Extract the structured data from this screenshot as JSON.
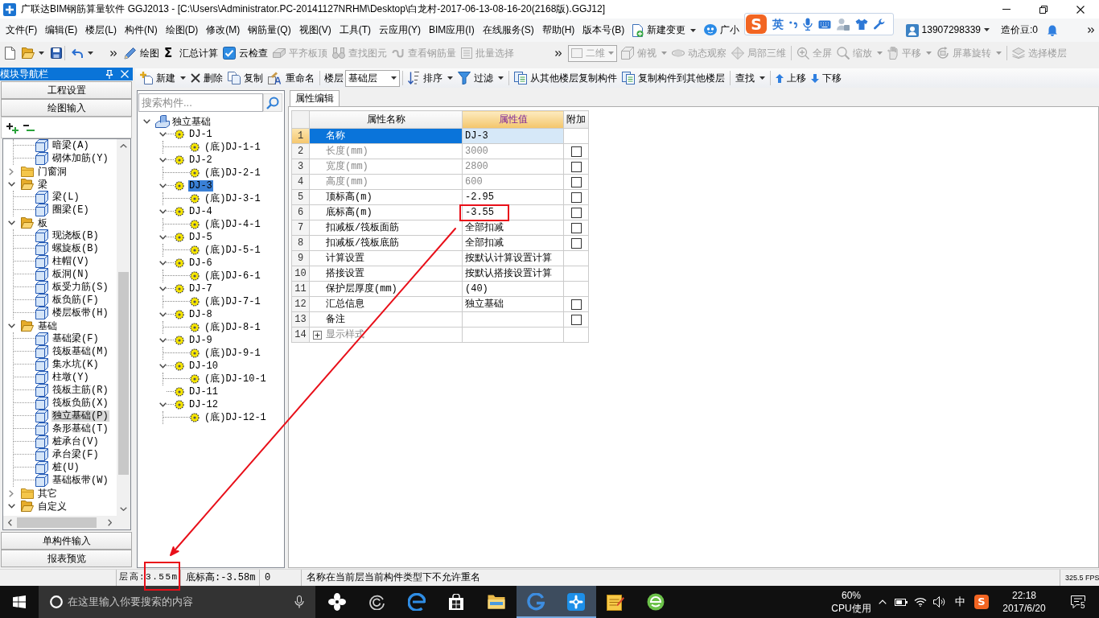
{
  "window": {
    "title": "广联达BIM钢筋算量软件 GGJ2013 - [C:\\Users\\Administrator.PC-20141127NRHM\\Desktop\\白龙村-2017-06-13-08-16-20(2168版).GGJ12]"
  },
  "menu_bar": {
    "items": [
      "文件(F)",
      "编辑(E)",
      "楼层(L)",
      "构件(N)",
      "绘图(D)",
      "修改(M)",
      "钢筋量(Q)",
      "视图(V)",
      "工具(T)",
      "云应用(Y)",
      "BIM应用(I)",
      "在线服务(S)",
      "帮助(H)",
      "版本号(B)"
    ],
    "change": {
      "label": "新建变更"
    },
    "assistant": {
      "label": "广小"
    },
    "account": {
      "phone": "13907298339",
      "beans": "造价豆:0"
    }
  },
  "ime_bar": {
    "logo": "S",
    "mode": "英"
  },
  "toolbar": {
    "actions": [
      {
        "label": "绘图",
        "disabled": false
      },
      {
        "label": "汇总计算",
        "symbol": "Σ",
        "disabled": false
      },
      {
        "label": "云检查",
        "disabled": false
      },
      {
        "label": "平齐板顶",
        "disabled": true
      },
      {
        "label": "查找图元",
        "disabled": true
      },
      {
        "label": "查看钢筋量",
        "disabled": true
      },
      {
        "label": "批量选择",
        "disabled": true
      }
    ],
    "view_mode": {
      "value": "二维",
      "disabled": true
    },
    "view_tools": [
      {
        "label": "俯视",
        "dropdown": true,
        "disabled": true
      },
      {
        "label": "动态观察",
        "dropdown": false,
        "disabled": true
      },
      {
        "label": "局部三维",
        "dropdown": false,
        "disabled": true
      },
      {
        "label": "全屏",
        "dropdown": false,
        "disabled": true
      },
      {
        "label": "缩放",
        "dropdown": true,
        "disabled": true
      },
      {
        "label": "平移",
        "dropdown": true,
        "disabled": true
      },
      {
        "label": "屏幕旋转",
        "dropdown": true,
        "disabled": true
      },
      {
        "label": "选择楼层",
        "dropdown": false,
        "disabled": true
      }
    ]
  },
  "component_toolbar": {
    "groups": [
      {
        "kind": "buttons",
        "buttons": [
          {
            "label": "新建",
            "dropdown": true
          },
          {
            "label": "删除",
            "dropdown": false
          },
          {
            "label": "复制",
            "dropdown": false
          },
          {
            "label": "重命名",
            "dropdown": false
          }
        ]
      },
      {
        "kind": "floor_select",
        "label": "楼层",
        "value": "基础层"
      },
      {
        "kind": "buttons",
        "buttons": [
          {
            "label": "排序",
            "dropdown": true
          },
          {
            "label": "过滤",
            "dropdown": true
          }
        ]
      },
      {
        "kind": "buttons",
        "buttons": [
          {
            "label": "从其他楼层复制构件",
            "dropdown": false
          },
          {
            "label": "复制构件到其他楼层",
            "dropdown": false
          }
        ]
      },
      {
        "kind": "buttons",
        "buttons": [
          {
            "label": "查找",
            "dropdown": true
          }
        ]
      },
      {
        "kind": "buttons",
        "buttons": [
          {
            "label": "上移",
            "dropdown": false
          },
          {
            "label": "下移",
            "dropdown": false
          }
        ]
      }
    ]
  },
  "nav_panel": {
    "title": "模块导航栏",
    "top_sections": [
      "工程设置",
      "绘图输入"
    ],
    "tree": [
      {
        "children": [
          {
            "label": "暗梁(A)",
            "selected": false
          },
          {
            "label": "砌体加筋(Y)",
            "selected": false
          }
        ]
      },
      {
        "label": "门窗洞",
        "expanded": false
      },
      {
        "label": "梁",
        "expanded": true,
        "children": [
          {
            "label": "梁(L)",
            "selected": false
          },
          {
            "label": "圈梁(E)",
            "selected": false
          }
        ]
      },
      {
        "label": "板",
        "expanded": true,
        "children": [
          {
            "label": "现浇板(B)",
            "selected": false
          },
          {
            "label": "螺旋板(B)",
            "selected": false
          },
          {
            "label": "柱帽(V)",
            "selected": false
          },
          {
            "label": "板洞(N)",
            "selected": false
          },
          {
            "label": "板受力筋(S)",
            "selected": false
          },
          {
            "label": "板负筋(F)",
            "selected": false
          },
          {
            "label": "楼层板带(H)",
            "selected": false
          }
        ]
      },
      {
        "label": "基础",
        "expanded": true,
        "children": [
          {
            "label": "基础梁(F)",
            "selected": false
          },
          {
            "label": "筏板基础(M)",
            "selected": false
          },
          {
            "label": "集水坑(K)",
            "selected": false
          },
          {
            "label": "柱墩(Y)",
            "selected": false
          },
          {
            "label": "筏板主筋(R)",
            "selected": false
          },
          {
            "label": "筏板负筋(X)",
            "selected": false
          },
          {
            "label": "独立基础(P)",
            "selected": true
          },
          {
            "label": "条形基础(T)",
            "selected": false
          },
          {
            "label": "桩承台(V)",
            "selected": false
          },
          {
            "label": "承台梁(F)",
            "selected": false
          },
          {
            "label": "桩(U)",
            "selected": false
          },
          {
            "label": "基础板带(W)",
            "selected": false
          }
        ]
      },
      {
        "label": "其它",
        "expanded": false
      },
      {
        "label": "自定义",
        "expanded": true
      }
    ],
    "bottom_sections": [
      "单构件输入",
      "报表预览"
    ]
  },
  "component_tree": {
    "search": {
      "placeholder": "搜索构件..."
    },
    "root": {
      "label": "独立基础",
      "expanded": true,
      "children": [
        {
          "label": "DJ-1",
          "expanded": true,
          "selected": false,
          "children": [
            {
              "label": "(底)DJ-1-1",
              "selected": false
            }
          ]
        },
        {
          "label": "DJ-2",
          "expanded": true,
          "selected": false,
          "children": [
            {
              "label": "(底)DJ-2-1",
              "selected": false
            }
          ]
        },
        {
          "label": "DJ-3",
          "expanded": true,
          "selected": true,
          "children": [
            {
              "label": "(底)DJ-3-1",
              "selected": false
            }
          ]
        },
        {
          "label": "DJ-4",
          "expanded": true,
          "selected": false,
          "children": [
            {
              "label": "(底)DJ-4-1",
              "selected": false
            }
          ]
        },
        {
          "label": "DJ-5",
          "expanded": true,
          "selected": false,
          "children": [
            {
              "label": "(底)DJ-5-1",
              "selected": false
            }
          ]
        },
        {
          "label": "DJ-6",
          "expanded": true,
          "selected": false,
          "children": [
            {
              "label": "(底)DJ-6-1",
              "selected": false
            }
          ]
        },
        {
          "label": "DJ-7",
          "expanded": true,
          "selected": false,
          "children": [
            {
              "label": "(底)DJ-7-1",
              "selected": false
            }
          ]
        },
        {
          "label": "DJ-8",
          "expanded": true,
          "selected": false,
          "children": [
            {
              "label": "(底)DJ-8-1",
              "selected": false
            }
          ]
        },
        {
          "label": "DJ-9",
          "expanded": true,
          "selected": false,
          "children": [
            {
              "label": "(底)DJ-9-1",
              "selected": false
            }
          ]
        },
        {
          "label": "DJ-10",
          "expanded": true,
          "selected": false,
          "children": [
            {
              "label": "(底)DJ-10-1",
              "selected": false
            }
          ]
        },
        {
          "label": "DJ-11",
          "selected": false
        },
        {
          "label": "DJ-12",
          "expanded": true,
          "selected": false,
          "children": [
            {
              "label": "(底)DJ-12-1",
              "selected": false
            }
          ]
        }
      ]
    }
  },
  "property_panel": {
    "tab": {
      "label": "属性编辑",
      "selected": true
    },
    "columns": [
      "属性名称",
      "属性值",
      "附加"
    ],
    "rows": [
      {
        "index": "1",
        "name": "名称",
        "value": "DJ-3",
        "selected": true,
        "disabled": false,
        "marked": false
      },
      {
        "index": "2",
        "name": "长度(mm)",
        "value": "3000",
        "selected": false,
        "disabled": true,
        "marked": false,
        "attach": {
          "checked": false
        }
      },
      {
        "index": "3",
        "name": "宽度(mm)",
        "value": "2800",
        "selected": false,
        "disabled": true,
        "marked": false,
        "attach": {
          "checked": false
        }
      },
      {
        "index": "4",
        "name": "高度(mm)",
        "value": "600",
        "selected": false,
        "disabled": true,
        "marked": false,
        "attach": {
          "checked": false
        }
      },
      {
        "index": "5",
        "name": "顶标高(m)",
        "value": "-2.95",
        "selected": false,
        "disabled": false,
        "marked": false,
        "attach": {
          "checked": false
        }
      },
      {
        "index": "6",
        "name": "底标高(m)",
        "value": "-3.55",
        "selected": false,
        "disabled": false,
        "marked": true,
        "attach": {
          "checked": false
        }
      },
      {
        "index": "7",
        "name": "扣减板/筏板面筋",
        "value": "全部扣减",
        "selected": false,
        "disabled": false,
        "marked": false,
        "attach": {
          "checked": false
        }
      },
      {
        "index": "8",
        "name": "扣减板/筏板底筋",
        "value": "全部扣减",
        "selected": false,
        "disabled": false,
        "marked": false,
        "attach": {
          "checked": false
        }
      },
      {
        "index": "9",
        "name": "计算设置",
        "value": "按默认计算设置计算",
        "selected": false,
        "disabled": false,
        "marked": false
      },
      {
        "index": "10",
        "name": "搭接设置",
        "value": "按默认搭接设置计算",
        "selected": false,
        "disabled": false,
        "marked": false
      },
      {
        "index": "11",
        "name": "保护层厚度(mm)",
        "value": "(40)",
        "selected": false,
        "disabled": false,
        "marked": false
      },
      {
        "index": "12",
        "name": "汇总信息",
        "value": "独立基础",
        "selected": false,
        "disabled": false,
        "marked": false,
        "attach": {
          "checked": false
        }
      },
      {
        "index": "13",
        "name": "备注",
        "selected": false,
        "disabled": false,
        "marked": false,
        "attach": {
          "checked": false
        }
      },
      {
        "index": "14",
        "name": "显示样式",
        "selected": false,
        "disabled": true,
        "marked": false,
        "expanded": false
      }
    ]
  },
  "status_bar": {
    "cells": [
      {
        "text": "层高:3.55m",
        "marked": true
      },
      {
        "text": "底标高:-3.58m",
        "marked": false
      },
      {
        "text": "0",
        "marked": false
      },
      {
        "text": "名称在当前层当前构件类型下不允许重名",
        "marked": false
      },
      {
        "text": "325.5 FPS",
        "marked": false
      }
    ]
  },
  "annotations": {
    "arrow": true
  },
  "taskbar": {
    "search": {
      "placeholder": "在这里输入你要搜索的内容"
    },
    "apps": [
      {
        "active": false
      },
      {
        "active": false
      },
      {
        "active": false
      },
      {
        "active": false
      },
      {
        "active": false
      },
      {
        "active": true
      },
      {
        "active": true
      },
      {
        "active": false
      },
      {
        "active": false
      }
    ],
    "cpu": {
      "value": "60%",
      "label": "CPU使用"
    },
    "tray": {
      "ime": "中",
      "ime_logo": "S",
      "time": "22:18",
      "date": "2017/6/20",
      "notifications": "5"
    }
  }
}
